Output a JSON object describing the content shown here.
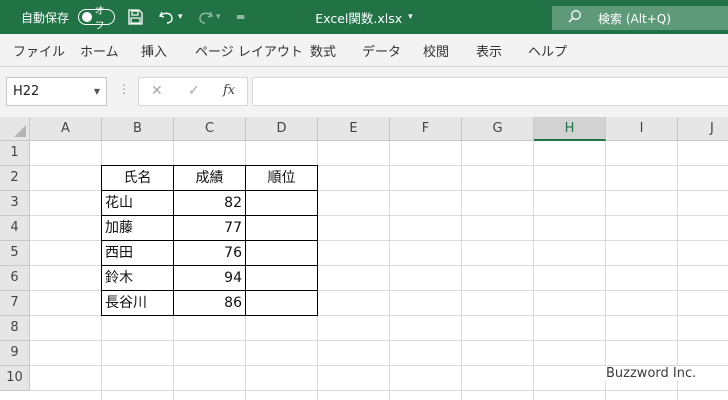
{
  "titlebar": {
    "autosave_label": "自動保存",
    "autosave_state": "オフ",
    "save_icon": "save-icon",
    "undo_icon": "undo-icon",
    "redo_icon": "redo-icon",
    "customize_icon": "customize-quick-access-icon",
    "file_title": "Excel関数.xlsx",
    "file_title_arrow": "▾",
    "search_label": "検索 (Alt+Q)",
    "bg_color": "#217346"
  },
  "ribbon": {
    "tabs": [
      "ファイル",
      "ホーム",
      "挿入",
      "ページ レイアウト",
      "数式",
      "データ",
      "校閲",
      "表示",
      "ヘルプ"
    ]
  },
  "formula_bar": {
    "name_box": "H22",
    "cancel": "✕",
    "enter": "✓",
    "fx": "fx",
    "formula": ""
  },
  "grid": {
    "columns": [
      "A",
      "B",
      "C",
      "D",
      "E",
      "F",
      "G",
      "H",
      "I",
      "J"
    ],
    "selected_column": "H",
    "rows": [
      "1",
      "2",
      "3",
      "4",
      "5",
      "6",
      "7",
      "8",
      "9",
      "10"
    ],
    "table_header": [
      "氏名",
      "成績",
      "順位"
    ],
    "table_rows": [
      {
        "name": "花山",
        "score": "82",
        "rank": ""
      },
      {
        "name": "加藤",
        "score": "77",
        "rank": ""
      },
      {
        "name": "西田",
        "score": "76",
        "rank": ""
      },
      {
        "name": "鈴木",
        "score": "94",
        "rank": ""
      },
      {
        "name": "長谷川",
        "score": "86",
        "rank": ""
      }
    ]
  },
  "watermark": "Buzzword Inc."
}
